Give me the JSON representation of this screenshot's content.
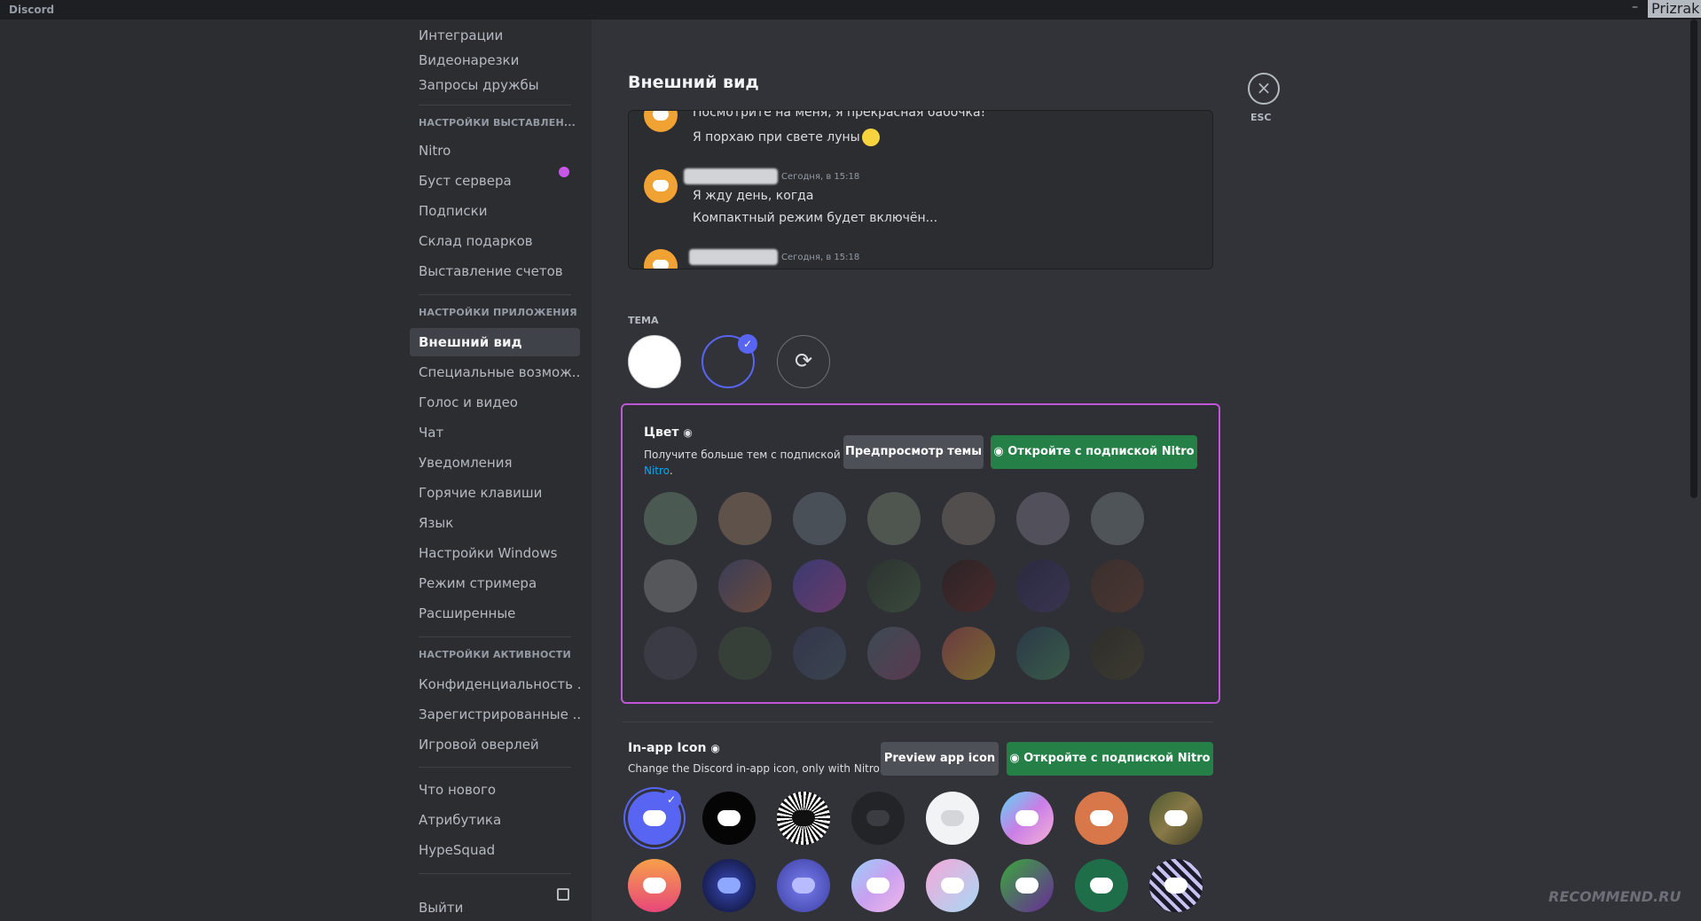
{
  "window": {
    "app_name": "Discord",
    "minimize": "–",
    "user": "Prizrak"
  },
  "sidebar": {
    "top_items": [
      "Интеграции",
      "Видеонарезки",
      "Запросы дружбы"
    ],
    "billing_header": "НАСТРОЙКИ ВЫСТАВЛЕН...",
    "billing_items": [
      "Nitro",
      "Буст сервера",
      "Подписки",
      "Склад подарков",
      "Выставление счетов"
    ],
    "app_header": "НАСТРОЙКИ ПРИЛОЖЕНИЯ",
    "app_items": [
      "Внешний вид",
      "Специальные возмож...",
      "Голос и видео",
      "Чат",
      "Уведомления",
      "Горячие клавиши",
      "Язык",
      "Настройки Windows",
      "Режим стримера",
      "Расширенные"
    ],
    "activity_header": "НАСТРОЙКИ АКТИВНОСТИ",
    "activity_items": [
      "Конфиденциальность ...",
      "Зарегистрированные ...",
      "Игровой оверлей"
    ],
    "misc_items": [
      "Что нового",
      "Атрибутика",
      "HypeSquad"
    ],
    "logout": "Выйти"
  },
  "main": {
    "title": "Внешний вид",
    "close_label": "ESC",
    "close_icon": "×",
    "preview": {
      "line1": "Посмотрите на меня, я прекрасная бабочка!",
      "line2": "Я порхаю при свете луны",
      "time1": "Сегодня, в 15:18",
      "line3": "Я жду день, когда",
      "line4": "Компактный режим будет включён...",
      "time2": "Сегодня, в 15:18"
    },
    "theme_label": "ТЕМА",
    "theme_check": "✓",
    "sync_icon": "⟳",
    "color": {
      "title": "Цвет",
      "desc": "Получите больше тем с подпиской",
      "desc_link": "Nitro",
      "desc_end": ".",
      "preview_btn": "Предпросмотр темы",
      "nitro_btn": "Откройте с подпиской Nitro"
    },
    "app_icon": {
      "title": "In-app Icon",
      "desc": "Change the Discord in-app icon, only with Nitro.",
      "preview_btn": "Preview app icon",
      "nitro_btn": "Откройте с подпиской Nitro",
      "check": "✓"
    }
  },
  "watermark": "RECOMMEND.RU",
  "colors": {
    "accent": "#5865f2",
    "nitro_border": "#c055d9",
    "green": "#248046",
    "link": "#00a8fc"
  }
}
